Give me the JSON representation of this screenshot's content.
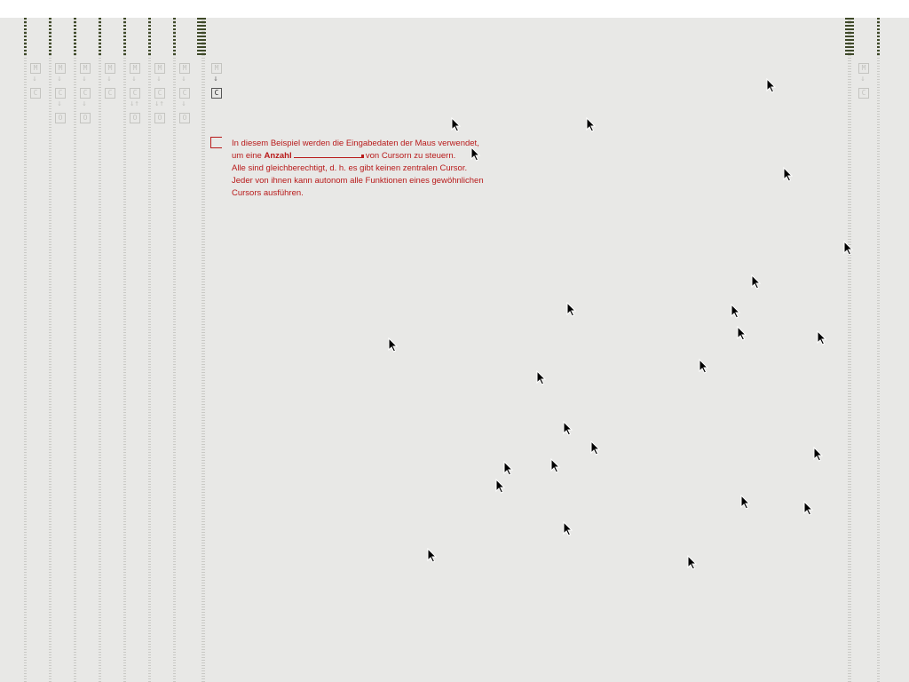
{
  "description": {
    "line1": "In diesem Beispiel werden die Eingabedaten der Maus verwendet,",
    "line2_prefix": "um eine",
    "line2_bold": "Anzahl",
    "line2_suffix": "von Cursorn zu steuern.",
    "line3": "Alle sind gleichberechtigt, d. h. es gibt keinen zentralen Cursor.",
    "line4": "Jeder von ihnen kann autonom alle Funktionen eines gewöhnlichen",
    "line5": "Cursors ausführen."
  },
  "anzahl_slider": {
    "value": 1.0
  },
  "node_labels": {
    "m": "M",
    "c": "C",
    "o": "O",
    "down": "↓",
    "updown": "↓↑"
  },
  "colors": {
    "accent": "#b81a1a",
    "background": "#e8e8e6",
    "rail": "#c9c9c5",
    "cap": "#3f4a2a"
  },
  "cursor_count": 28
}
